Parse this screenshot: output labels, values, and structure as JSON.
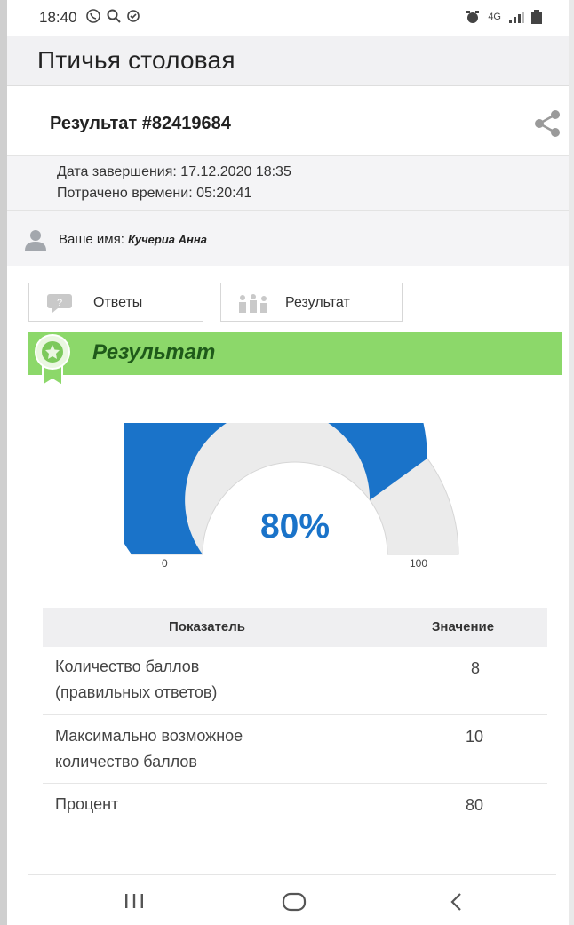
{
  "status": {
    "time": "18:40",
    "network": "4G"
  },
  "app": {
    "title": "Птичья столовая"
  },
  "result": {
    "heading": "Результат #82419684",
    "completion": "Дата завершения: 17.12.2020 18:35",
    "time_spent": "Потрачено времени: 05:20:41",
    "name_label": "Ваше имя: ",
    "name_value": "Кучериа Анна"
  },
  "tabs": {
    "answers": "Ответы",
    "result": "Результат"
  },
  "banner": {
    "title": "Результат",
    "color": "#8cd86a"
  },
  "gauge": {
    "percent": 80,
    "label": "80%",
    "min": "0",
    "max": "100",
    "fill_color": "#1a73c9",
    "track_color": "#ebebeb"
  },
  "table": {
    "headers": {
      "name": "Показатель",
      "value": "Значение"
    },
    "rows": [
      {
        "name_line1": "Количество баллов",
        "name_line2": "(правильных ответов)",
        "value": "8"
      },
      {
        "name_line1": "Максимально возможное",
        "name_line2": "количество баллов",
        "value": "10"
      },
      {
        "name_line1": "Процент",
        "name_line2": "",
        "value": "80"
      }
    ]
  },
  "icons": {
    "share": "share-icon",
    "user": "user-icon",
    "answers": "question-bubble-icon",
    "result": "people-chart-icon",
    "banner": "award-ribbon-icon",
    "nav_recent": "recent-apps-icon",
    "nav_home": "home-icon",
    "nav_back": "back-icon"
  }
}
